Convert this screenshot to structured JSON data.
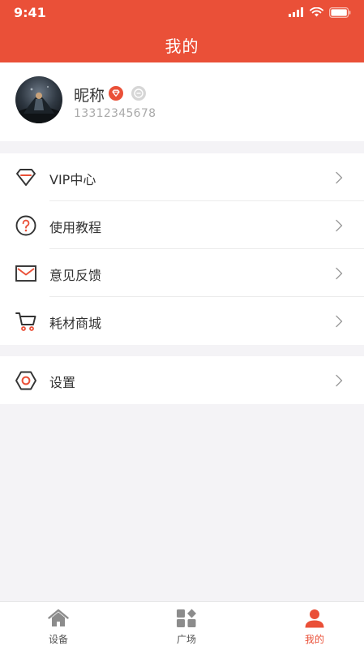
{
  "status_bar": {
    "time": "9:41"
  },
  "header": {
    "title": "我的",
    "background_color": "#ea5038"
  },
  "profile": {
    "nickname": "昵称",
    "phone": "13312345678",
    "vip_badge_color": "#ea5038"
  },
  "menu": {
    "group1": [
      {
        "label": "VIP中心",
        "icon": "diamond-icon"
      },
      {
        "label": "使用教程",
        "icon": "question-icon"
      },
      {
        "label": "意见反馈",
        "icon": "mail-icon"
      },
      {
        "label": "耗材商城",
        "icon": "cart-icon"
      }
    ],
    "group2": [
      {
        "label": "设置",
        "icon": "settings-hexagon-icon"
      }
    ]
  },
  "tabbar": {
    "items": [
      {
        "label": "设备",
        "icon": "home-icon",
        "active": false
      },
      {
        "label": "广场",
        "icon": "grid-icon",
        "active": false
      },
      {
        "label": "我的",
        "icon": "person-icon",
        "active": true
      }
    ],
    "active_color": "#ea5038"
  }
}
